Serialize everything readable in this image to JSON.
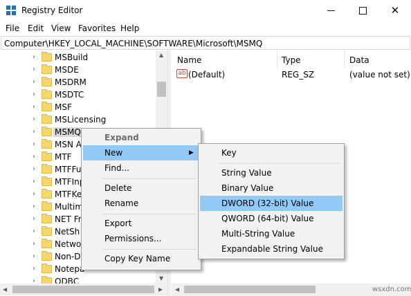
{
  "window": {
    "title": "Registry Editor",
    "min_glyph": "",
    "close_glyph": "✕"
  },
  "menu": [
    "File",
    "Edit",
    "View",
    "Favorites",
    "Help"
  ],
  "address": "Computer\\HKEY_LOCAL_MACHINE\\SOFTWARE\\Microsoft\\MSMQ",
  "tree": {
    "items": [
      "MSBuild",
      "MSDE",
      "MSDRM",
      "MSDTC",
      "MSF",
      "MSLicensing",
      "MSMQ",
      "MSN A",
      "MTF",
      "MTFFu",
      "MTFInp",
      "MTFKe",
      "Multim",
      "NET Fra",
      "NetSh",
      "Networ",
      "Non-D",
      "Notepa",
      "ODBC"
    ],
    "selected": "MSMQ"
  },
  "list": {
    "columns": {
      "name": "Name",
      "type": "Type",
      "data": "Data"
    },
    "rows": [
      {
        "icon": "ab",
        "name": "(Default)",
        "type": "REG_SZ",
        "data": "(value not set)"
      }
    ]
  },
  "context_menu": {
    "expand": "Expand",
    "new": "New",
    "find": "Find...",
    "delete": "Delete",
    "rename": "Rename",
    "export": "Export",
    "permissions": "Permissions...",
    "copy_key_name": "Copy Key Name"
  },
  "submenu": {
    "key": "Key",
    "string": "String Value",
    "binary": "Binary Value",
    "dword": "DWORD (32-bit) Value",
    "qword": "QWORD (64-bit) Value",
    "multi_string": "Multi-String Value",
    "expandable": "Expandable String Value",
    "highlighted": "DWORD (32-bit) Value"
  },
  "watermark": "wsxdn.com",
  "colors": {
    "highlight": "#91c9f7",
    "menu_bg": "#f2f2f2",
    "folder": "#f5d76e",
    "accent": "#1e72c4"
  }
}
